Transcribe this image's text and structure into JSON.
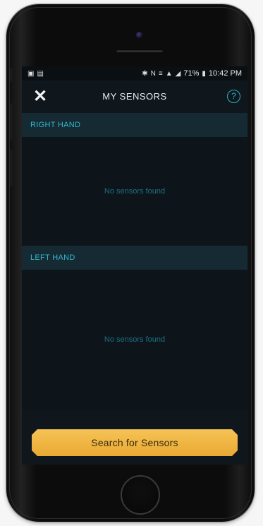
{
  "status_bar": {
    "time": "10:42 PM",
    "battery": "71%",
    "left_icons": [
      "image-notification-icon",
      "document-notification-icon"
    ],
    "right_icons": [
      "bluetooth-icon",
      "nfc-icon",
      "vibrate-icon",
      "wifi-icon",
      "signal-icon",
      "battery-icon"
    ]
  },
  "header": {
    "title": "MY SENSORS",
    "close_icon": "close-icon",
    "help_icon": "help-icon",
    "help_glyph": "?",
    "close_glyph": "✕"
  },
  "sections": [
    {
      "title": "RIGHT HAND",
      "empty_text": "No sensors found"
    },
    {
      "title": "LEFT HAND",
      "empty_text": "No sensors found"
    }
  ],
  "search_button": {
    "label": "Search for Sensors"
  },
  "colors": {
    "accent": "#35b6cf",
    "button": "#f0b840",
    "background": "#0f171d"
  }
}
